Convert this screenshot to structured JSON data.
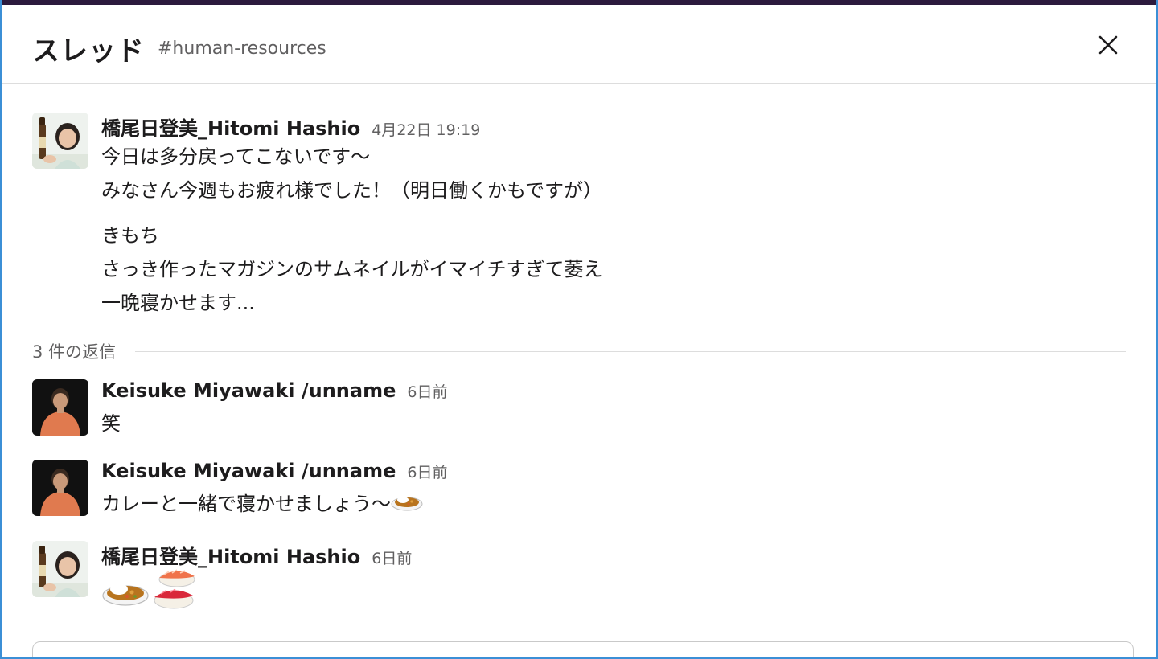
{
  "header": {
    "title": "スレッド",
    "channel": "#human-resources"
  },
  "parent": {
    "author": "橋尾日登美_Hitomi Hashio",
    "timestamp": "4月22日 19:19",
    "lines": [
      "今日は多分戻ってこないです〜",
      "みなさん今週もお疲れ様でした！（明日働くかもですが）",
      "きもち",
      "さっき作ったマガジンのサムネイルがイマイチすぎて萎え",
      "一晩寝かせます..."
    ]
  },
  "replies_label": "3 件の返信",
  "replies": [
    {
      "author": "Keisuke Miyawaki /unname",
      "timestamp": "6日前",
      "text": "笑"
    },
    {
      "author": "Keisuke Miyawaki /unname",
      "timestamp": "6日前",
      "text": "カレーと一緒で寝かせましょう〜",
      "emoji": "curry-rice-emoji"
    },
    {
      "author": "橋尾日登美_Hitomi Hashio",
      "timestamp": "6日前",
      "text": "",
      "emojis": [
        "curry-rice-emoji",
        "sushi-emoji"
      ]
    }
  ],
  "icons": {
    "close": "close-icon"
  },
  "colors": {
    "top_bar": "#2c1a3d",
    "frame_border": "#3b8fd6",
    "secondary_text": "#616061"
  }
}
